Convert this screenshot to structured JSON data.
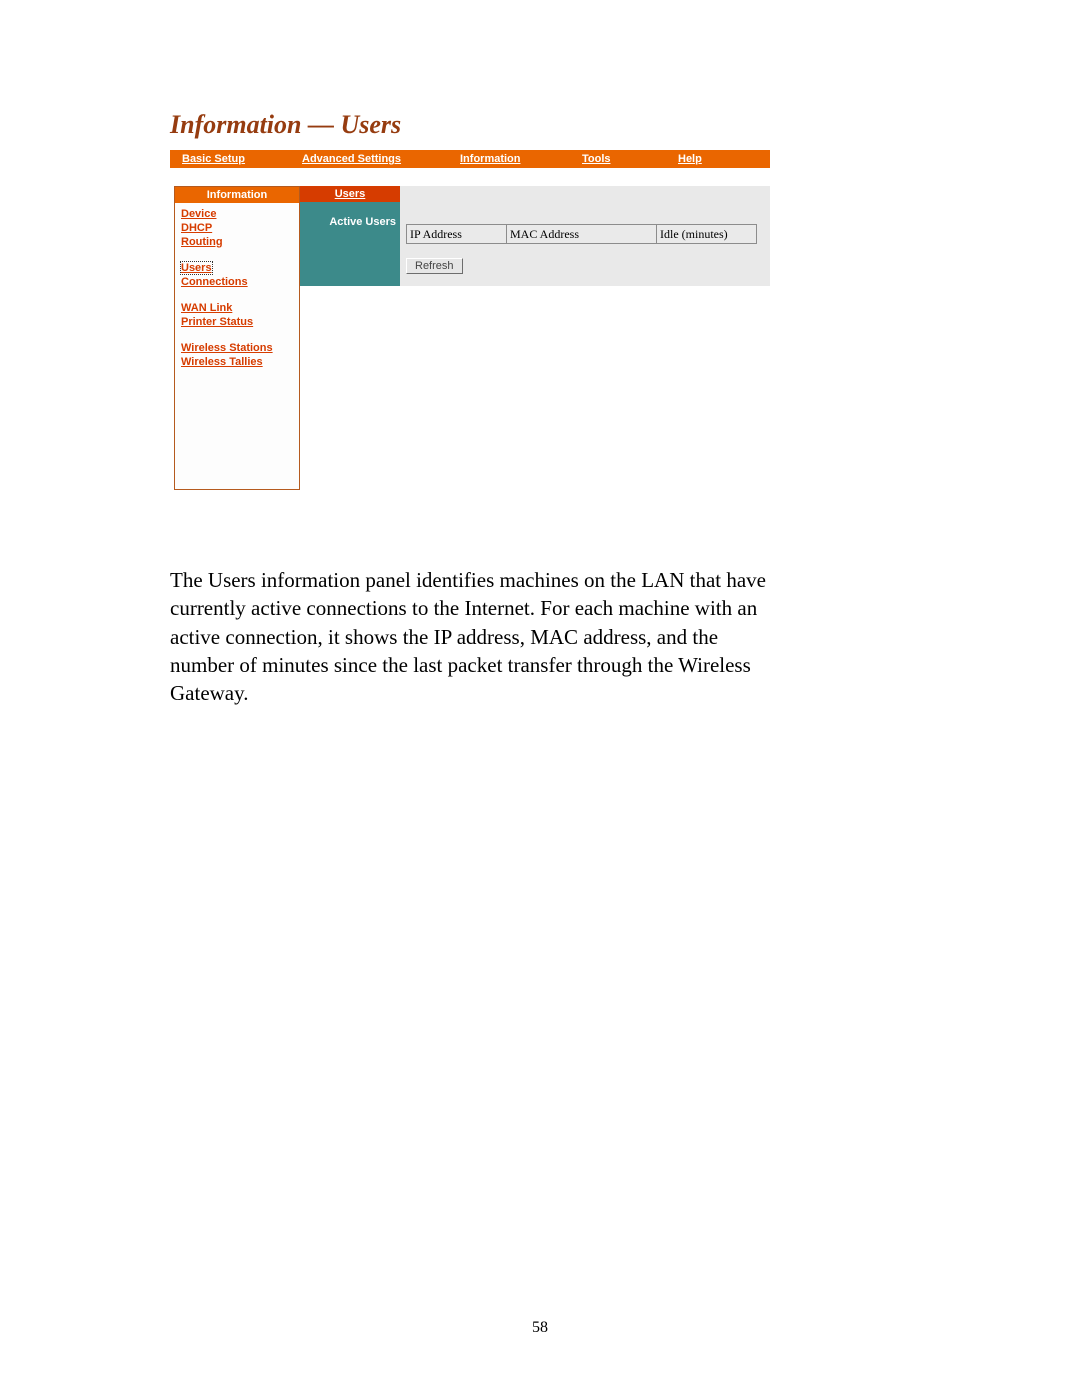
{
  "heading": "Information  — Users",
  "topnav": {
    "basic_setup": "Basic Setup",
    "advanced_settings": "Advanced Settings",
    "information": "Information",
    "tools": "Tools",
    "help": "Help"
  },
  "sidebar": {
    "header": "Information",
    "links": {
      "device": "Device",
      "dhcp": "DHCP",
      "routing": "Routing",
      "users": "Users",
      "connections": "Connections",
      "wan_link": "WAN Link",
      "printer_status": "Printer Status",
      "wireless_stations": "Wireless Stations",
      "wireless_tallies": "Wireless Tallies"
    }
  },
  "subpanel": {
    "title": "Users",
    "subtitle": "Active Users"
  },
  "table_headers": {
    "ip": "IP Address",
    "mac": "MAC Address",
    "idle": "Idle (minutes)"
  },
  "buttons": {
    "refresh": "Refresh"
  },
  "paragraph": "The Users information panel identifies machines on the LAN that have currently active connections to the Internet. For each machine with an active connection, it shows the IP address, MAC address, and the number of minutes since the last packet transfer through the Wireless Gateway.",
  "page_number": "58"
}
